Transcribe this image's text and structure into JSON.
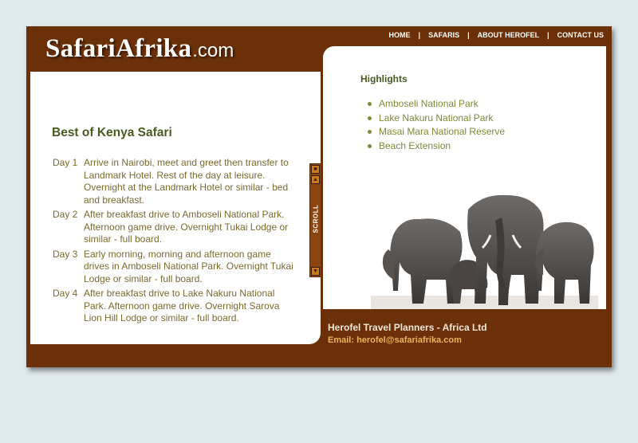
{
  "site": {
    "logo_main": "SafariAfrika",
    "logo_tld": ".com"
  },
  "nav": {
    "items": [
      {
        "label": "HOME"
      },
      {
        "label": "SAFARIS"
      },
      {
        "label": "ABOUT HEROFEL"
      },
      {
        "label": "CONTACT US"
      }
    ],
    "separator": "|"
  },
  "page": {
    "title": "Best of Kenya Safari"
  },
  "itinerary": [
    {
      "day": "Day 1",
      "text": "Arrive in Nairobi, meet and greet then transfer to Landmark Hotel. Rest of the day at leisure. Overnight at the Landmark Hotel or similar - bed and breakfast."
    },
    {
      "day": "Day 2",
      "text": "After breakfast drive to Amboseli National Park. Afternoon game drive. Overnight Tukai Lodge or similar - full board."
    },
    {
      "day": "Day 3",
      "text": "Early morning, morning and afternoon game drives in Amboseli National Park. Overnight Tukai Lodge or similar - full board."
    },
    {
      "day": "Day 4",
      "text": "After breakfast drive to Lake Nakuru National Park. Afternoon game drive. Overnight Sarova Lion Hill Lodge or similar - full board."
    }
  ],
  "scroll": {
    "label": "SCROLL",
    "up_glyph": "▲",
    "down_glyph": "▼",
    "top_glyph": "■"
  },
  "highlights": {
    "title": "Highlights",
    "items": [
      "Amboseli National Park",
      "Lake Nakuru National Park",
      "Masai Mara National Reserve",
      "Beach Extension"
    ]
  },
  "footer": {
    "company": "Herofel Travel Planners - Africa Ltd",
    "email": "Email: herofel@safariafrika.com"
  },
  "colors": {
    "brand_brown": "#6b3008",
    "heading_olive": "#4b5a1f",
    "body_text": "#7a6a2c",
    "list_text": "#7d8a34",
    "scrollbar": "#8c4510",
    "page_bg": "#dfe9ee"
  }
}
